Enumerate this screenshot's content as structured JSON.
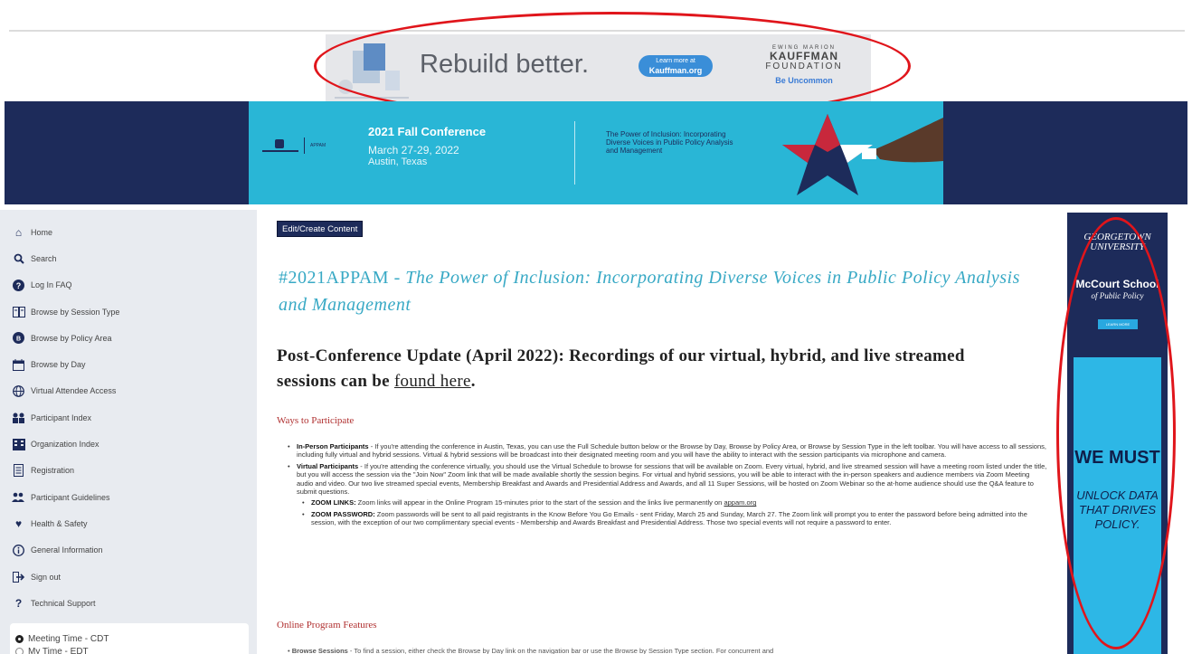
{
  "top_ad": {
    "tagline": "Rebuild better.",
    "learn_small": "Learn more at",
    "learn_big": "Kauffman.org",
    "kf_small": "EWING MARION",
    "kf_name": "KAUFFMAN",
    "kf_found": "FOUNDATION",
    "kf_slogan": "Be Uncommon"
  },
  "banner": {
    "org_mini": "APPAM",
    "conference": "2021 Fall Conference",
    "dates": "March 27-29, 2022",
    "location": "Austin, Texas",
    "theme": "The Power of Inclusion: Incorporating Diverse Voices in Public Policy Analysis and Management"
  },
  "sidebar": {
    "items": [
      {
        "label": "Home",
        "icon": "home-icon"
      },
      {
        "label": "Search",
        "icon": "search-icon"
      },
      {
        "label": "Log In FAQ",
        "icon": "question-icon"
      },
      {
        "label": "Browse by Session Type",
        "icon": "session-type-icon"
      },
      {
        "label": "Browse by Policy Area",
        "icon": "policy-area-icon"
      },
      {
        "label": "Browse by Day",
        "icon": "calendar-icon"
      },
      {
        "label": "Virtual Attendee Access",
        "icon": "globe-icon"
      },
      {
        "label": "Participant Index",
        "icon": "participants-icon"
      },
      {
        "label": "Organization Index",
        "icon": "building-icon"
      },
      {
        "label": "Registration",
        "icon": "document-icon"
      },
      {
        "label": "Participant Guidelines",
        "icon": "group-icon"
      },
      {
        "label": "Health & Safety",
        "icon": "heart-icon"
      },
      {
        "label": "General Information",
        "icon": "info-icon"
      },
      {
        "label": "Sign out",
        "icon": "sign-out-icon"
      },
      {
        "label": "Technical Support",
        "icon": "help-icon"
      }
    ],
    "time_options": [
      "Meeting Time - CDT",
      "My Time - EDT"
    ]
  },
  "main": {
    "edit_button": "Edit/Create Content",
    "title_hash": "#2021APPAM - ",
    "title_italic": "The Power of Inclusion: Incorporating Diverse Voices in Public Policy Analysis and Management",
    "update_prefix": "Post-Conference Update (April 2022): Recordings of our virtual, hybrid, and live streamed sessions can be ",
    "update_link": "found here",
    "update_suffix": ".",
    "section1": "Ways to Participate",
    "inperson_label": "In-Person Participants",
    "inperson_text": " - If you're attending the conference in Austin, Texas, you can use the Full Schedule button below or the Browse by Day, Browse by Policy Area, or Browse by Session Type in the left toolbar. You will have access to all sessions, including fully virtual and hybrid sessions. Virtual & hybrid sessions will be broadcast into their designated meeting room and you will have the ability to interact with the session participants via microphone and camera.",
    "virtual_label": "Virtual Participants",
    "virtual_text": " - If you're attending the conference virtually, you should use the Virtual Schedule to browse for sessions that will be available on Zoom. Every virtual, hybrid, and live streamed session will have a meeting room listed under the title, but you will access the session via the \"Join Now\" Zoom link that will be made available shortly the session begins. For virtual and hybrid sessions, you will be able to interact with the in-person speakers and audience members via Zoom Meeting audio and video. Our two live streamed special events, Membership Breakfast and Awards and Presidential Address and Awards, and all 11 Super Sessions, will be hosted on Zoom Webinar so the at-home audience should use the Q&A feature to submit questions.",
    "zoom_links_label": "ZOOM LINKS:",
    "zoom_links_text": " Zoom links will appear in the Online Program 15-minutes prior to the start of the session and the links live permanently on ",
    "zoom_links_link": "appam.org",
    "zoom_pw_label": "ZOOM PASSWORD:",
    "zoom_pw_text": " Zoom passwords will be sent to all paid registrants in the Know Before You Go Emails - sent Friday, March 25 and Sunday, March 27. The Zoom link will prompt you to enter the password before being admitted into the session, with the exception of our two complimentary special events - Membership and Awards Breakfast and Presidential Address. Those two special events will not require a password to enter.",
    "section2": "Online Program Features",
    "browse_label": "Browse Sessions",
    "browse_text": " - To find a session, either check the Browse by Day link on the navigation bar or use the Browse by Session Type section. For concurrent and"
  },
  "right_ad": {
    "university": "GEORGETOWN UNIVERSITY",
    "school": "McCourt School",
    "policy": "of Public Policy",
    "learn": "LEARN MORE",
    "we": "WE MUST",
    "unlock": "UNLOCK DATA THAT DRIVES POLICY."
  },
  "colors": {
    "navy": "#1d2b5a",
    "cyan": "#29b6d6",
    "title_teal": "#38a9c5",
    "section_red": "#b03030",
    "annotation_red": "#e0151b"
  }
}
